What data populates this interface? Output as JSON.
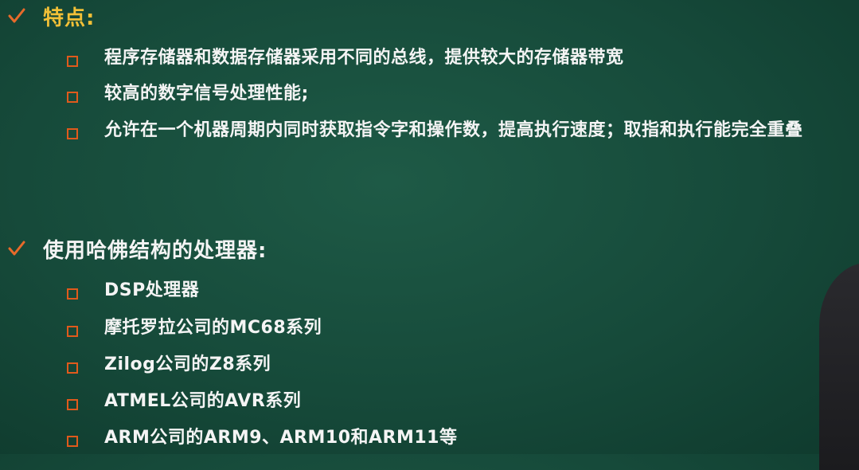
{
  "section_features": {
    "title": "特点:",
    "items": [
      "程序存储器和数据存储器采用不同的总线，提供较大的存储器带宽",
      "较高的数字信号处理性能;",
      "允许在一个机器周期内同时获取指令字和操作数，提高执行速度；取指和执行能完全重叠"
    ]
  },
  "section_processors": {
    "title": "使用哈佛结构的处理器:",
    "items": [
      "DSP处理器",
      "摩托罗拉公司的MC68系列",
      "Zilog公司的Z8系列",
      "ATMEL公司的AVR系列",
      "ARM公司的ARM9、ARM10和ARM11等"
    ]
  },
  "colors": {
    "background": "#164a3a",
    "heading_accent": "#f2c037",
    "check_mark": "#e86a2a",
    "bullet_border": "#e05a1c",
    "text": "#f4f4f4"
  },
  "icons": {
    "check": "check-mark-icon",
    "bullet": "hollow-square-bullet-icon"
  }
}
